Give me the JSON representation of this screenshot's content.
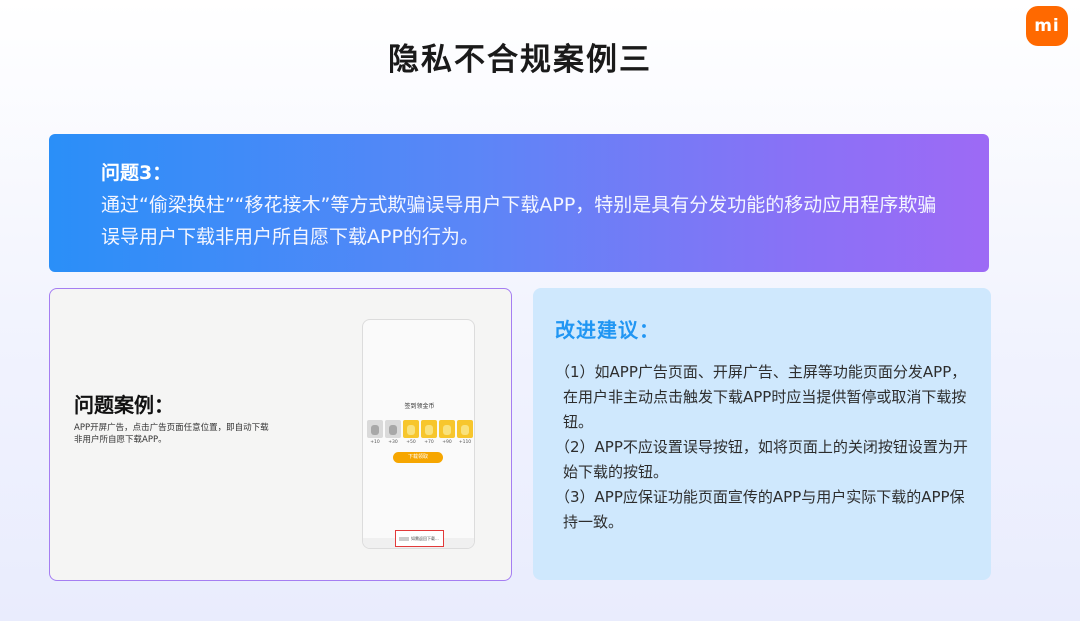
{
  "logo": {
    "text": "mi"
  },
  "title": "隐私不合规案例三",
  "problem": {
    "label": "问题3：",
    "text": "通过“偷梁换柱”“移花接木”等方式欺骗误导用户下载APP，特别是具有分发功能的移动应用程序欺骗误导用户下载非用户所自愿下载APP的行为。"
  },
  "case": {
    "title": "问题案例：",
    "description": "APP开屏广告，点击广告页面任意位置，即自动下载非用户所自愿下载APP。",
    "phone": {
      "heading": "签到领金币",
      "coins": [
        "+10",
        "+30",
        "+50",
        "+70",
        "+90",
        "+110"
      ],
      "button_label": "下载领取",
      "red_box_text": "如需返回下载..."
    }
  },
  "suggestions": {
    "title": "改进建议：",
    "items": [
      "（1）如APP广告页面、开屏广告、主屏等功能页面分发APP，在用户非主动点击触发下载APP时应当提供暂停或取消下载按钮。",
      "（2）APP不应设置误导按钮，如将页面上的关闭按钮设置为开始下载的按钮。",
      "（3）APP应保证功能页面宣传的APP与用户实际下载的APP保持一致。"
    ]
  },
  "colors": {
    "accent_orange": "#ff6900",
    "banner_start": "#2a8ff8",
    "banner_end": "#9d6af5",
    "suggest_title": "#2196f3",
    "suggest_bg": "#cfe8fd"
  }
}
